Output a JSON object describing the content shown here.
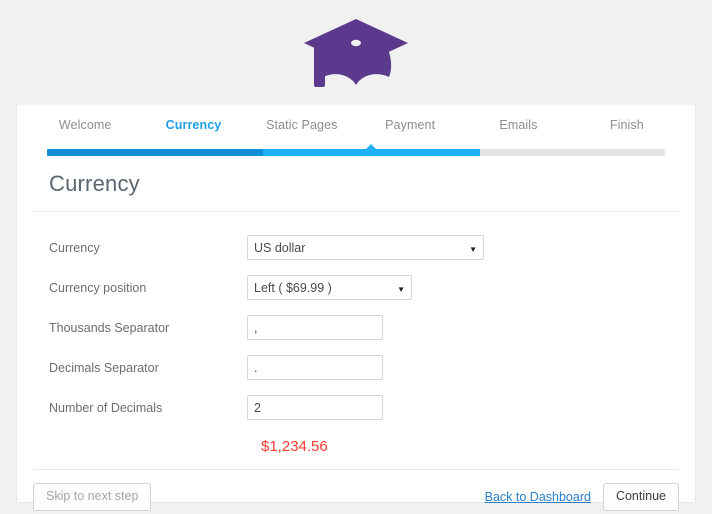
{
  "logo": {
    "name": "graduation-cap-logo",
    "color": "#5b3a8e"
  },
  "steps": [
    {
      "label": "Welcome",
      "active": false
    },
    {
      "label": "Currency",
      "active": true
    },
    {
      "label": "Static Pages",
      "active": false
    },
    {
      "label": "Payment",
      "active": false
    },
    {
      "label": "Emails",
      "active": false
    },
    {
      "label": "Finish",
      "active": false
    }
  ],
  "progress": {
    "done_percent": 35,
    "current_percent": 35,
    "colors": {
      "done": "#0f8fd6",
      "current": "#1fb0f5",
      "track": "#e3e3e3"
    }
  },
  "page": {
    "title": "Currency"
  },
  "form": {
    "fields": [
      {
        "label": "Currency",
        "type": "select",
        "value": "US dollar",
        "options": [
          "US dollar"
        ],
        "name": "currency-select"
      },
      {
        "label": "Currency position",
        "type": "select",
        "value": "Left ( $69.99 )",
        "options": [
          "Left ( $69.99 )"
        ],
        "name": "currency-position-select"
      },
      {
        "label": "Thousands Separator",
        "type": "text",
        "value": ",",
        "placeholder": "",
        "name": "thousands-separator-input"
      },
      {
        "label": "Decimals Separator",
        "type": "text",
        "value": ".",
        "placeholder": "",
        "name": "decimals-separator-input"
      },
      {
        "label": "Number of Decimals",
        "type": "text",
        "value": "2",
        "placeholder": "",
        "name": "number-of-decimals-input"
      }
    ],
    "preview": {
      "text": "$1,234.56",
      "color": "#ff3b30"
    }
  },
  "footer": {
    "skip_label": "Skip to next step",
    "dashboard_link": "Back to Dashboard",
    "continue_label": "Continue"
  },
  "icons": {
    "caret_down": "▼"
  }
}
